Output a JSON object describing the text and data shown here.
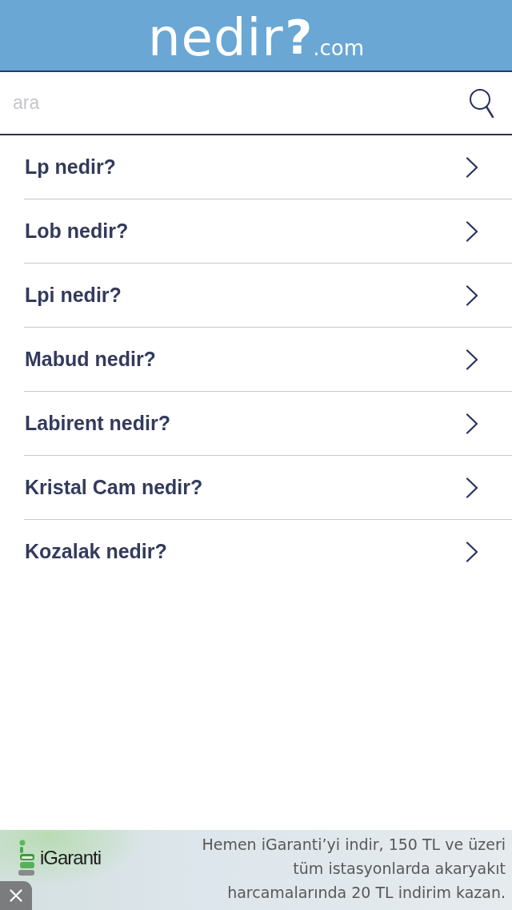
{
  "header": {
    "logo": {
      "name": "nedir",
      "mark": "?",
      "domain": ".com"
    }
  },
  "search": {
    "placeholder": "ara"
  },
  "items": [
    {
      "label": "Lp nedir?"
    },
    {
      "label": "Lob nedir?"
    },
    {
      "label": "Lpi nedir?"
    },
    {
      "label": "Mabud nedir?"
    },
    {
      "label": "Labirent nedir?"
    },
    {
      "label": "Kristal Cam nedir?"
    },
    {
      "label": "Kozalak nedir?"
    }
  ],
  "ad": {
    "brand": "iGaranti",
    "lines": [
      "Hemen iGaranti’yi indir, 150 TL ve üzeri",
      "tüm istasyonlarda akaryakıt",
      "harcamalarında 20 TL indirim kazan."
    ]
  }
}
